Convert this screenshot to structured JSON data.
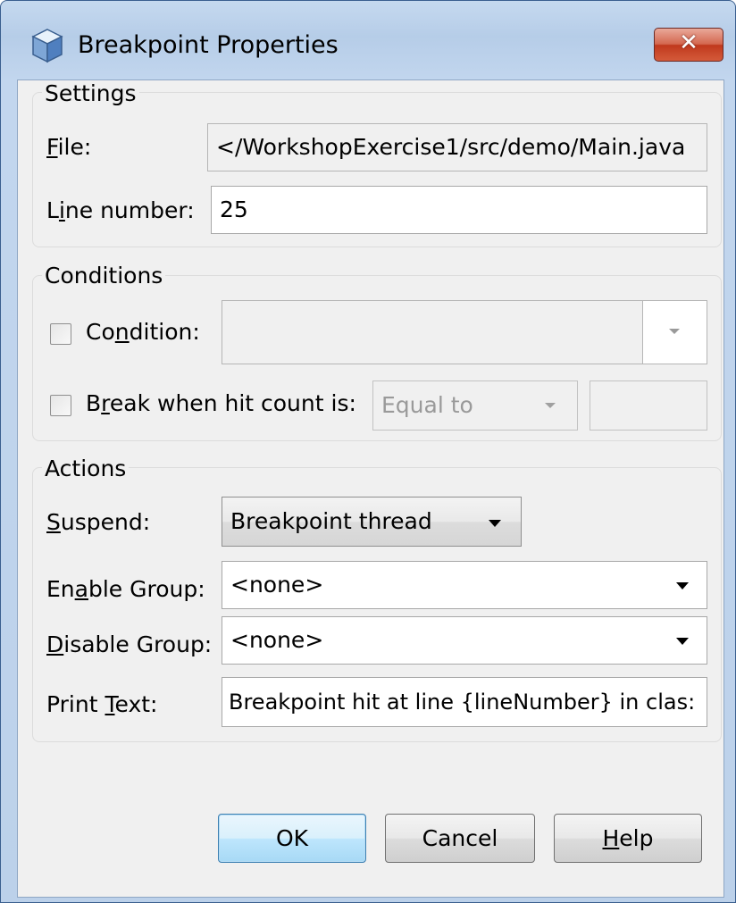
{
  "window": {
    "title": "Breakpoint Properties",
    "close_glyph": "✕",
    "icon": "cube-icon"
  },
  "settings": {
    "legend": "Settings",
    "file_label": "File:",
    "file_mnemonic": "F",
    "file_rest": "ile:",
    "file_value": "</WorkshopExercise1/src/demo/Main.java",
    "line_label": "Line number:",
    "line_pre": "L",
    "line_mnemonic": "i",
    "line_rest": "ne number:",
    "line_value": "25"
  },
  "conditions": {
    "legend": "Conditions",
    "condition_pre": "Co",
    "condition_mnemonic": "n",
    "condition_rest": "dition:",
    "condition_checked": false,
    "condition_value": "",
    "hitcount_pre": "B",
    "hitcount_mnemonic": "r",
    "hitcount_rest": "eak when hit count is:",
    "hitcount_checked": false,
    "hitcount_mode": "Equal to",
    "hitcount_value": ""
  },
  "actions": {
    "legend": "Actions",
    "suspend_mnemonic": "S",
    "suspend_rest": "uspend:",
    "suspend_value": "Breakpoint thread",
    "enable_pre": "En",
    "enable_mnemonic": "a",
    "enable_rest": "ble Group:",
    "enable_value": "<none>",
    "disable_mnemonic": "D",
    "disable_rest": "isable Group:",
    "disable_value": "<none>",
    "print_pre": "Print ",
    "print_mnemonic": "T",
    "print_rest": "ext:",
    "print_value": "Breakpoint hit at line {lineNumber} in clas:"
  },
  "buttons": {
    "ok": "OK",
    "cancel": "Cancel",
    "help_mnemonic": "H",
    "help_rest": "elp"
  },
  "colors": {
    "title_bar": "#b6cde8",
    "close_button": "#c0391d",
    "default_button": "#bee6fd"
  }
}
